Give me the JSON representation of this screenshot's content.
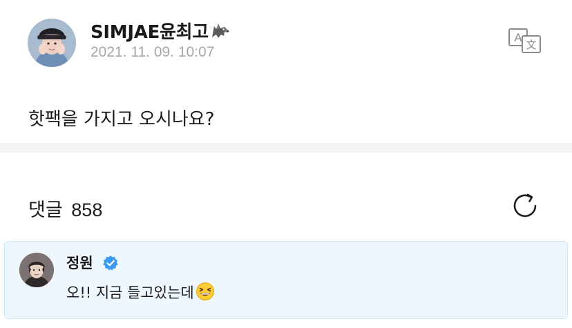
{
  "post": {
    "author": "SIMJAE윤최고",
    "author_emoji": "wolf-icon",
    "date": "2021. 11. 09. 10:07",
    "body": "핫팩을 가지고 오시나요?",
    "translate_icon": "translate-icon"
  },
  "comments": {
    "label": "댓글",
    "count": "858",
    "refresh_icon": "refresh-icon",
    "items": [
      {
        "author": "정원",
        "verified": true,
        "text": "오!! 지금 들고있는데",
        "emoji": "grinning-squinting-face-icon"
      }
    ]
  },
  "colors": {
    "date": "#a7a7a7",
    "divider": "#f4f4f6",
    "comment_bg": "#eef7fd",
    "comment_border": "#cfe6f5",
    "verified": "#3b9bf0"
  }
}
